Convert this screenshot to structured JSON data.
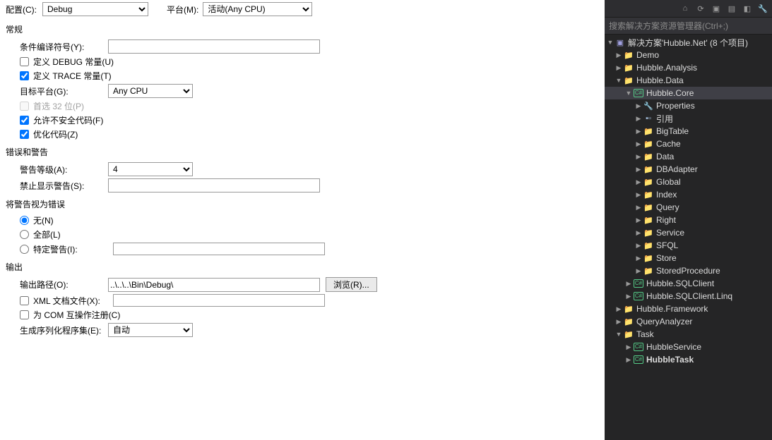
{
  "top": {
    "config_label": "配置(C):",
    "config_value": "Debug",
    "platform_label": "平台(M):",
    "platform_value": "活动(Any CPU)"
  },
  "sections": {
    "general": "常规",
    "errors": "错误和警告",
    "treat_as_err": "将警告视为错误",
    "output": "输出"
  },
  "general": {
    "cond_sym_label": "条件编译符号(Y):",
    "cond_sym_value": "",
    "debug_const": "定义 DEBUG 常量(U)",
    "trace_const": "定义 TRACE 常量(T)",
    "target_plat_label": "目标平台(G):",
    "target_plat_value": "Any CPU",
    "prefer_32": "首选 32 位(P)",
    "allow_unsafe": "允许不安全代码(F)",
    "optimize": "优化代码(Z)"
  },
  "err": {
    "warn_level_label": "警告等级(A):",
    "warn_level_value": "4",
    "suppress_label": "禁止显示警告(S):",
    "suppress_value": ""
  },
  "treat": {
    "none": "无(N)",
    "all": "全部(L)",
    "specific": "特定警告(I):",
    "specific_value": ""
  },
  "output": {
    "outpath_label": "输出路径(O):",
    "outpath_value": "..\\..\\..\\Bin\\Debug\\",
    "browse": "浏览(R)...",
    "xml_doc": "XML 文档文件(X):",
    "com_interop": "为 COM 互操作注册(C)",
    "gen_serial": "生成序列化程序集(E):",
    "gen_serial_value": "自动"
  },
  "explorer": {
    "search_placeholder": "搜索解决方案资源管理器(Ctrl+;)",
    "solution": "解决方案'Hubble.Net' (8 个项目)",
    "tree": [
      {
        "depth": 0,
        "arrow": "▶",
        "icon": "folder",
        "label": "Demo"
      },
      {
        "depth": 0,
        "arrow": "▶",
        "icon": "folder",
        "label": "Hubble.Analysis"
      },
      {
        "depth": 0,
        "arrow": "▼",
        "icon": "folder",
        "label": "Hubble.Data"
      },
      {
        "depth": 1,
        "arrow": "▼",
        "icon": "cs",
        "label": "Hubble.Core",
        "selected": true
      },
      {
        "depth": 2,
        "arrow": "▶",
        "icon": "wrench",
        "label": "Properties"
      },
      {
        "depth": 2,
        "arrow": "▶",
        "icon": "reflink",
        "label": "引用"
      },
      {
        "depth": 2,
        "arrow": "▶",
        "icon": "folder",
        "label": "BigTable"
      },
      {
        "depth": 2,
        "arrow": "▶",
        "icon": "folder",
        "label": "Cache"
      },
      {
        "depth": 2,
        "arrow": "▶",
        "icon": "folder",
        "label": "Data"
      },
      {
        "depth": 2,
        "arrow": "▶",
        "icon": "folder",
        "label": "DBAdapter"
      },
      {
        "depth": 2,
        "arrow": "▶",
        "icon": "folder",
        "label": "Global"
      },
      {
        "depth": 2,
        "arrow": "▶",
        "icon": "folder",
        "label": "Index"
      },
      {
        "depth": 2,
        "arrow": "▶",
        "icon": "folder",
        "label": "Query"
      },
      {
        "depth": 2,
        "arrow": "▶",
        "icon": "folder",
        "label": "Right"
      },
      {
        "depth": 2,
        "arrow": "▶",
        "icon": "folder",
        "label": "Service"
      },
      {
        "depth": 2,
        "arrow": "▶",
        "icon": "folder",
        "label": "SFQL"
      },
      {
        "depth": 2,
        "arrow": "▶",
        "icon": "folder",
        "label": "Store"
      },
      {
        "depth": 2,
        "arrow": "▶",
        "icon": "folder",
        "label": "StoredProcedure"
      },
      {
        "depth": 1,
        "arrow": "▶",
        "icon": "cs",
        "label": "Hubble.SQLClient"
      },
      {
        "depth": 1,
        "arrow": "▶",
        "icon": "cs",
        "label": "Hubble.SQLClient.Linq"
      },
      {
        "depth": 0,
        "arrow": "▶",
        "icon": "folder",
        "label": "Hubble.Framework"
      },
      {
        "depth": 0,
        "arrow": "▶",
        "icon": "folder",
        "label": "QueryAnalyzer"
      },
      {
        "depth": 0,
        "arrow": "▼",
        "icon": "folder",
        "label": "Task"
      },
      {
        "depth": 1,
        "arrow": "▶",
        "icon": "cs",
        "label": "HubbleService"
      },
      {
        "depth": 1,
        "arrow": "▶",
        "icon": "cs",
        "label": "HubbleTask",
        "bold": true
      }
    ]
  }
}
